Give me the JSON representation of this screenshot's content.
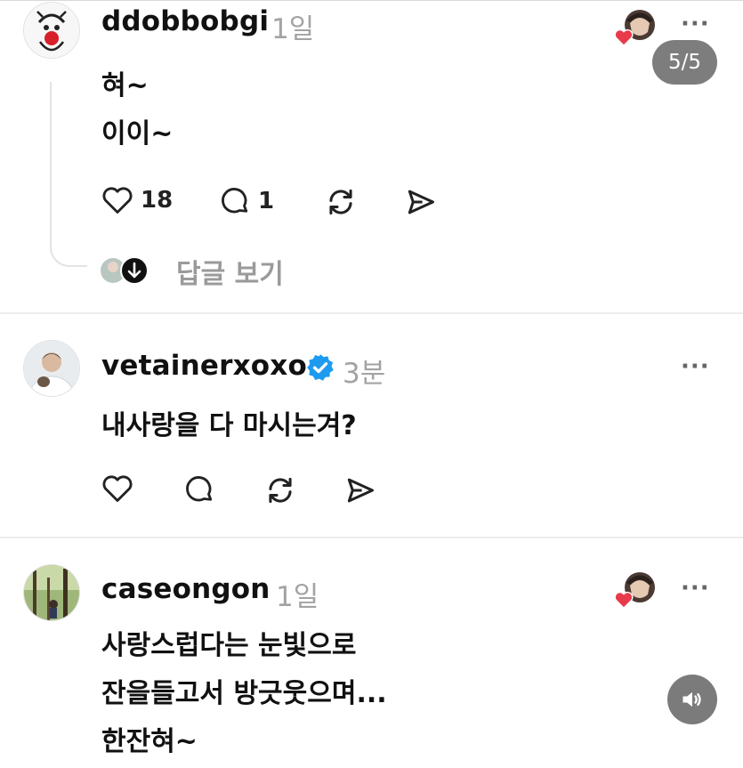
{
  "posts": [
    {
      "username": "ddobbobgi",
      "time": "1일",
      "lines": [
        "혀~",
        "이이~"
      ],
      "likes": "18",
      "replies": "1",
      "view_replies": "답글 보기",
      "media_counter": "5/5",
      "more": "···"
    },
    {
      "username": "vetainerxoxo",
      "verified": true,
      "time": "3분",
      "lines": [
        "내사랑을 다 마시는겨?"
      ],
      "more": "···"
    },
    {
      "username": "caseongon",
      "time": "1일",
      "lines": [
        "사랑스럽다는 눈빛으로",
        "잔을들고서 방긋웃으며...",
        "한잔혀~"
      ],
      "more": "···"
    }
  ],
  "icons": {
    "like": "heart-icon",
    "comment": "comment-icon",
    "repost": "repost-icon",
    "share": "send-icon",
    "verified": "verified-badge-icon",
    "sound": "speaker-icon"
  },
  "colors": {
    "verified": "#1d9bf0",
    "liked_heart": "#e83a4a",
    "muted_text": "#a3a3a3"
  }
}
